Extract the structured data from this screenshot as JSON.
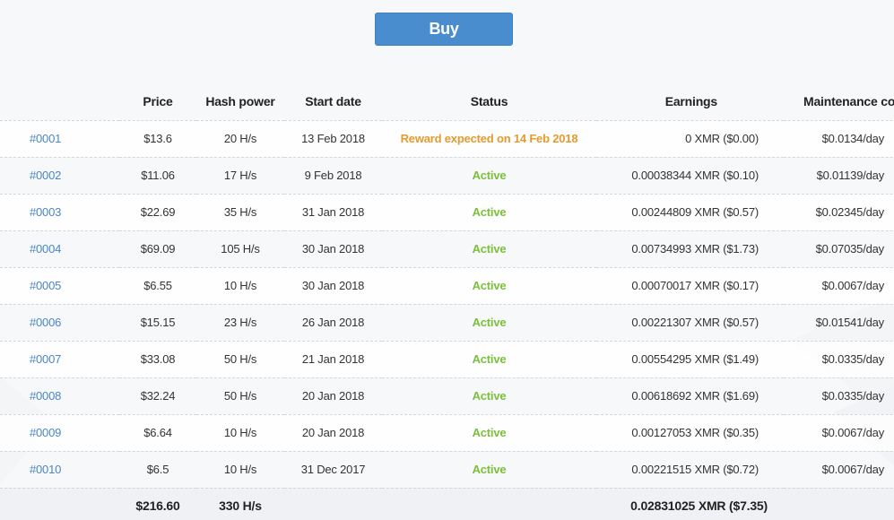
{
  "buy_button": {
    "label": "Buy"
  },
  "table": {
    "headers": {
      "id": "",
      "price": "Price",
      "hash_power": "Hash power",
      "start_date": "Start date",
      "status": "Status",
      "earnings": "Earnings",
      "maintenance": "Maintenance cost"
    },
    "rows": [
      {
        "id": "#0001",
        "price": "$13.6",
        "hash": "20 H/s",
        "date": "13 Feb 2018",
        "status": "Reward expected on 14 Feb 2018",
        "status_kind": "pending",
        "earnings": "0 XMR  ($0.00)",
        "maintenance": "$0.0134/day"
      },
      {
        "id": "#0002",
        "price": "$11.06",
        "hash": "17 H/s",
        "date": "9 Feb 2018",
        "status": "Active",
        "status_kind": "active",
        "earnings": "0.00038344 XMR  ($0.10)",
        "maintenance": "$0.01139/day"
      },
      {
        "id": "#0003",
        "price": "$22.69",
        "hash": "35 H/s",
        "date": "31 Jan 2018",
        "status": "Active",
        "status_kind": "active",
        "earnings": "0.00244809 XMR  ($0.57)",
        "maintenance": "$0.02345/day"
      },
      {
        "id": "#0004",
        "price": "$69.09",
        "hash": "105 H/s",
        "date": "30 Jan 2018",
        "status": "Active",
        "status_kind": "active",
        "earnings": "0.00734993 XMR  ($1.73)",
        "maintenance": "$0.07035/day"
      },
      {
        "id": "#0005",
        "price": "$6.55",
        "hash": "10 H/s",
        "date": "30 Jan 2018",
        "status": "Active",
        "status_kind": "active",
        "earnings": "0.00070017 XMR  ($0.17)",
        "maintenance": "$0.0067/day"
      },
      {
        "id": "#0006",
        "price": "$15.15",
        "hash": "23 H/s",
        "date": "26 Jan 2018",
        "status": "Active",
        "status_kind": "active",
        "earnings": "0.00221307 XMR  ($0.57)",
        "maintenance": "$0.01541/day"
      },
      {
        "id": "#0007",
        "price": "$33.08",
        "hash": "50 H/s",
        "date": "21 Jan 2018",
        "status": "Active",
        "status_kind": "active",
        "earnings": "0.00554295 XMR  ($1.49)",
        "maintenance": "$0.0335/day"
      },
      {
        "id": "#0008",
        "price": "$32.24",
        "hash": "50 H/s",
        "date": "20 Jan 2018",
        "status": "Active",
        "status_kind": "active",
        "earnings": "0.00618692 XMR  ($1.69)",
        "maintenance": "$0.0335/day"
      },
      {
        "id": "#0009",
        "price": "$6.64",
        "hash": "10 H/s",
        "date": "20 Jan 2018",
        "status": "Active",
        "status_kind": "active",
        "earnings": "0.00127053 XMR  ($0.35)",
        "maintenance": "$0.0067/day"
      },
      {
        "id": "#0010",
        "price": "$6.5",
        "hash": "10 H/s",
        "date": "31 Dec 2017",
        "status": "Active",
        "status_kind": "active",
        "earnings": "0.00221515 XMR  ($0.72)",
        "maintenance": "$0.0067/day"
      }
    ],
    "totals": {
      "price": "$216.60",
      "hash": "330 H/s",
      "earnings": "0.02831025 XMR  ($7.35)"
    }
  },
  "colors": {
    "accent": "#4a8dce",
    "link": "#4a86c5",
    "active": "#7cbf3a",
    "pending": "#e49b2c"
  }
}
